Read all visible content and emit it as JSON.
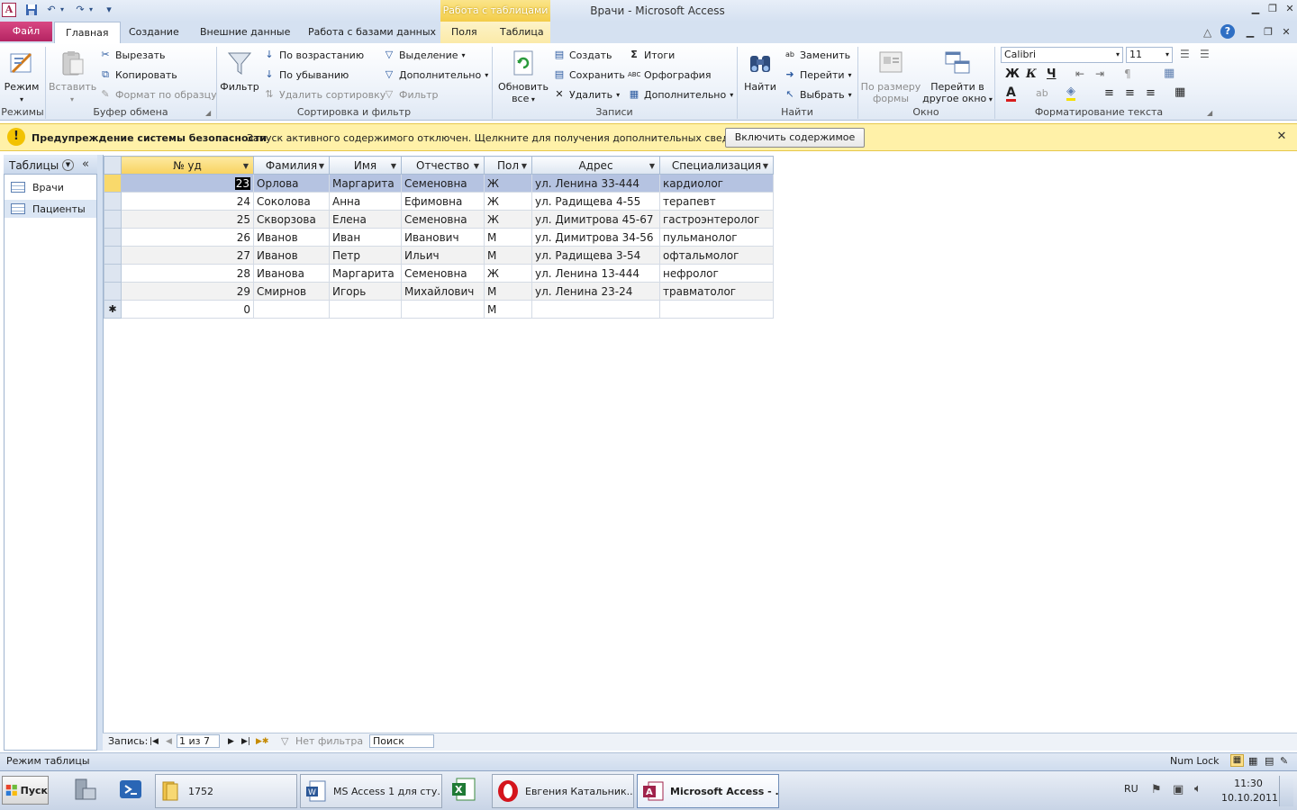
{
  "quick_access": {
    "app_icon": "A",
    "save_icon": "save-icon",
    "undo_icon": "undo-icon",
    "redo_icon": "redo-icon"
  },
  "window": {
    "title": "Врачи  -  Microsoft Access",
    "context_tab_header": "Работа с таблицами"
  },
  "tabs": [
    {
      "label": "Файл"
    },
    {
      "label": "Главная"
    },
    {
      "label": "Создание"
    },
    {
      "label": "Внешние данные"
    },
    {
      "label": "Работа с базами данных"
    },
    {
      "label": "Поля"
    },
    {
      "label": "Таблица"
    }
  ],
  "ribbon": {
    "views": {
      "label": "Режимы",
      "mode": "Режим"
    },
    "clipboard": {
      "label": "Буфер обмена",
      "paste": "Вставить",
      "cut": "Вырезать",
      "copy": "Копировать",
      "format_painter": "Формат по образцу"
    },
    "sort_filter": {
      "label": "Сортировка и фильтр",
      "filter": "Фильтр",
      "ascending": "По возрастанию",
      "descending": "По убыванию",
      "remove_sort": "Удалить сортировку",
      "selection": "Выделение",
      "advanced": "Дополнительно",
      "toggle_filter": "Фильтр"
    },
    "records": {
      "label": "Записи",
      "refresh": "Обновить",
      "refresh2": "все",
      "new": "Создать",
      "save": "Сохранить",
      "delete": "Удалить",
      "totals": "Итоги",
      "spelling": "Орфография",
      "more": "Дополнительно"
    },
    "find": {
      "label": "Найти",
      "find": "Найти",
      "replace": "Заменить",
      "goto": "Перейти",
      "select": "Выбрать"
    },
    "window": {
      "label": "Окно",
      "fit": "По размеру",
      "fit2": "формы",
      "switch": "Перейти в",
      "switch2": "другое окно"
    },
    "text_format": {
      "label": "Форматирование текста",
      "font": "Calibri",
      "size": "11",
      "bold": "Ж",
      "italic": "К",
      "underline": "Ч"
    }
  },
  "security": {
    "title": "Предупреждение системы безопасности",
    "message": "Запуск активного содержимого отключен. Щелкните для получения дополнительных сведений.",
    "button": "Включить содержимое"
  },
  "nav": {
    "title": "Таблицы",
    "items": [
      {
        "label": "Врачи"
      },
      {
        "label": "Пациенты"
      }
    ]
  },
  "table": {
    "columns": [
      "№ уд",
      "Фамилия",
      "Имя",
      "Отчество",
      "Пол",
      "Адрес",
      "Специализация"
    ],
    "rows": [
      [
        "23",
        "Орлова",
        "Маргарита",
        "Семеновна",
        "Ж",
        "ул. Ленина 33-444",
        "кардиолог"
      ],
      [
        "24",
        "Соколова",
        "Анна",
        "Ефимовна",
        "Ж",
        "ул. Радищева 4-55",
        "терапевт"
      ],
      [
        "25",
        "Скворзова",
        "Елена",
        "Семеновна",
        "Ж",
        "ул. Димитрова 45-67",
        "гастроэнтеролог"
      ],
      [
        "26",
        "Иванов",
        "Иван",
        "Иванович",
        "М",
        "ул. Димитрова 34-56",
        "пульманолог"
      ],
      [
        "27",
        "Иванов",
        "Петр",
        "Ильич",
        "М",
        "ул. Радищева 3-54",
        "офтальмолог"
      ],
      [
        "28",
        "Иванова",
        "Маргарита",
        "Семеновна",
        "Ж",
        "ул. Ленина 13-444",
        "нефролог"
      ],
      [
        "29",
        "Смирнов",
        "Игорь",
        "Михайлович",
        "М",
        "ул. Ленина 23-24",
        "травматолог"
      ]
    ],
    "new_row": {
      "marker": "✱",
      "id": "0",
      "sex": "М"
    }
  },
  "record_nav": {
    "label": "Запись:",
    "position": "1 из 7",
    "filter": "Нет фильтра",
    "search": "Поиск"
  },
  "status": {
    "mode": "Режим таблицы",
    "numlock": "Num Lock"
  },
  "taskbar": {
    "start": "Пуск",
    "items": [
      {
        "label": "1752"
      },
      {
        "label": "MS Access 1 для сту..."
      },
      {
        "label": "Евгения Катальник..."
      },
      {
        "label": "Microsoft Access - ..."
      }
    ],
    "lang": "RU",
    "time": "11:30",
    "date": "10.10.2011"
  },
  "colors": {
    "file_tab": "#b42462",
    "security_bar": "#fff1a8",
    "current_row": "#b5c3e1",
    "context_tab": "#f3cc48"
  }
}
